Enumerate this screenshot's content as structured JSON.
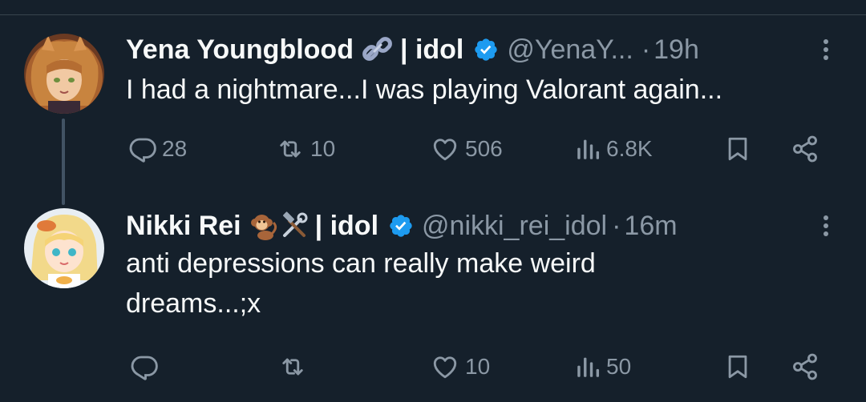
{
  "tweets": [
    {
      "display_name": "Yena Youngblood",
      "name_emojis": [
        "link-emoji"
      ],
      "idol_tag": "| idol",
      "handle": "@YenaY...",
      "separator": "·",
      "time": "19h",
      "text": "I had a nightmare...I was playing Valorant again...",
      "replies": "28",
      "retweets": "10",
      "likes": "506",
      "views": "6.8K"
    },
    {
      "display_name": "Nikki Rei",
      "name_emojis": [
        "monkey-emoji",
        "hammer-wrench-emoji"
      ],
      "idol_tag": "| idol",
      "handle": "@nikki_rei_idol",
      "separator": "·",
      "time": "16m",
      "text": "anti depressions can really make weird dreams...;x",
      "replies": "",
      "retweets": "",
      "likes": "10",
      "views": "50"
    }
  ],
  "colors": {
    "background": "#15202b",
    "text": "#f7f9f9",
    "muted": "#8b98a5",
    "verified": "#1d9bf0",
    "divider": "#38444d"
  }
}
